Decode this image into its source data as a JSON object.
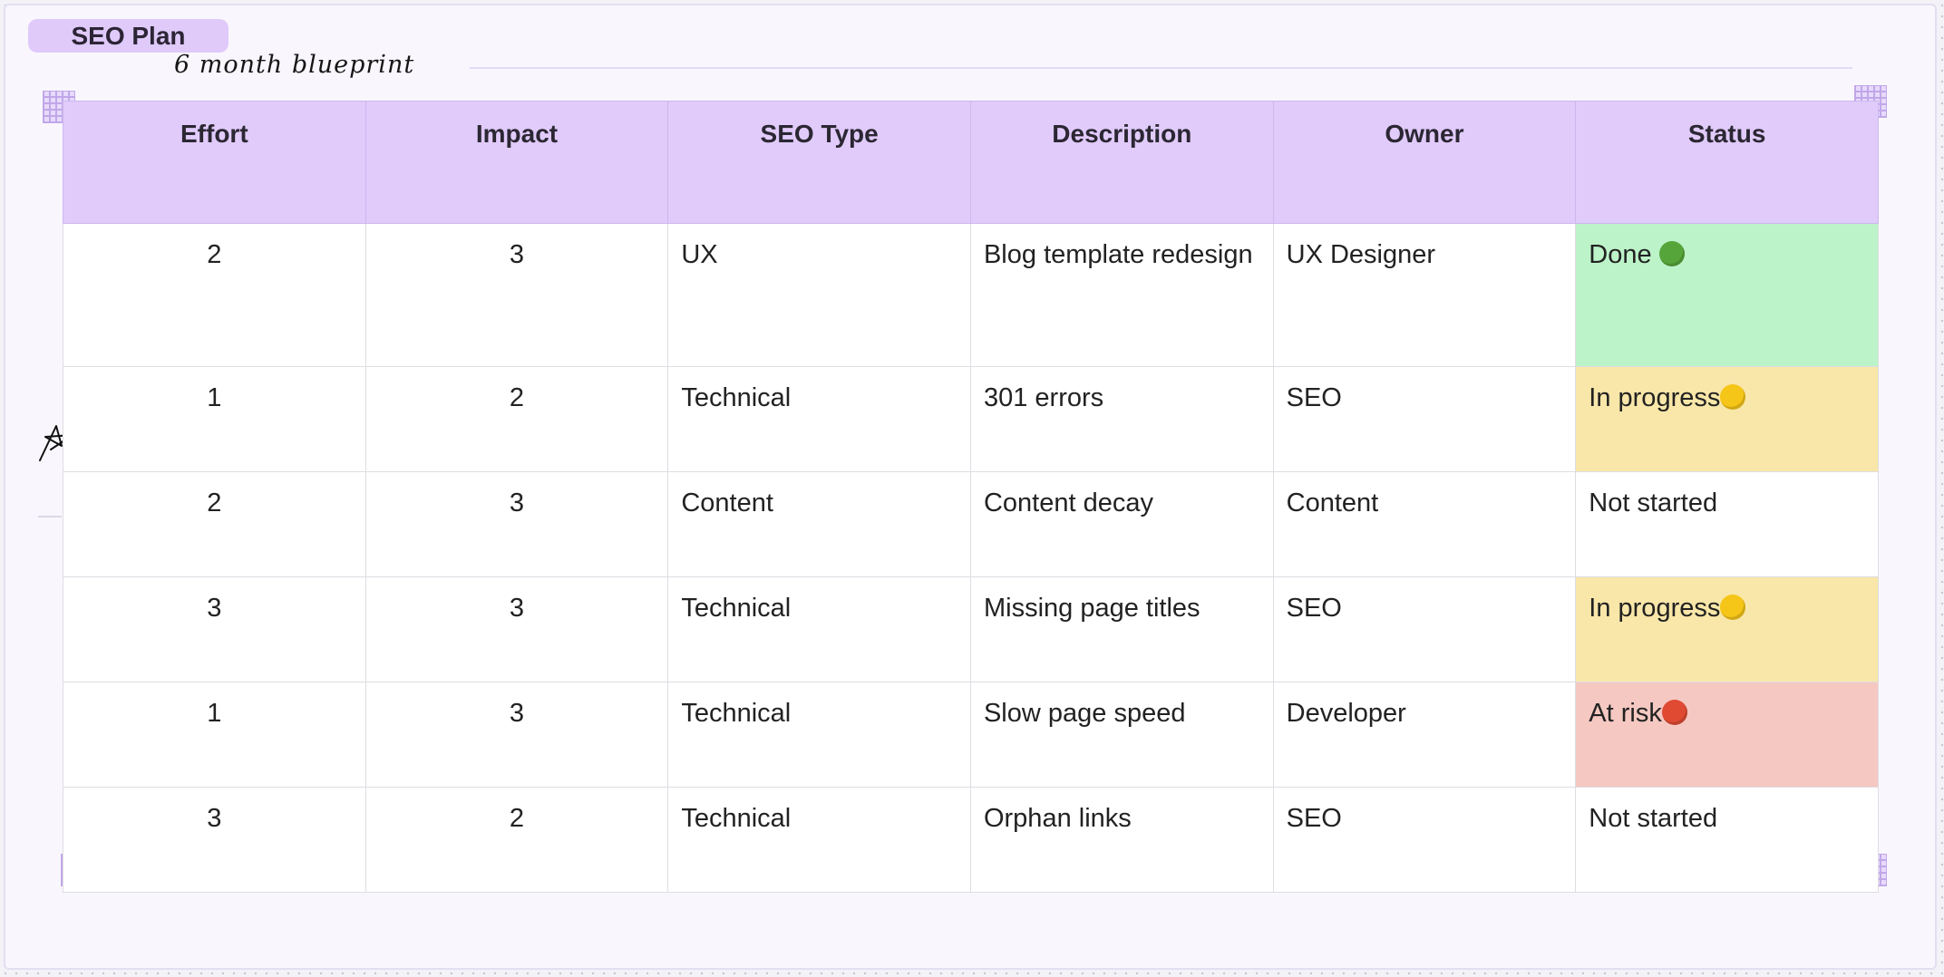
{
  "header": {
    "tag": "SEO Plan",
    "subtitle": "6 month blueprint"
  },
  "table": {
    "columns": [
      "Effort",
      "Impact",
      "SEO Type",
      "Description",
      "Owner",
      "Status"
    ],
    "rows": [
      {
        "effort": "2",
        "impact": "3",
        "type": "UX",
        "description": "Blog template redesign",
        "owner": "UX Designer",
        "status": "Done ",
        "status_key": "done"
      },
      {
        "effort": "1",
        "impact": "2",
        "type": "Technical",
        "description": "301 errors",
        "owner": "SEO",
        "status": "In progress",
        "status_key": "progress"
      },
      {
        "effort": "2",
        "impact": "3",
        "type": "Content",
        "description": "Content decay",
        "owner": "Content",
        "status": "Not started",
        "status_key": "none"
      },
      {
        "effort": "3",
        "impact": "3",
        "type": "Technical",
        "description": "Missing page titles",
        "owner": "SEO",
        "status": "In progress",
        "status_key": "progress"
      },
      {
        "effort": "1",
        "impact": "3",
        "type": "Technical",
        "description": "Slow page speed",
        "owner": "Developer",
        "status": "At risk",
        "status_key": "risk"
      },
      {
        "effort": "3",
        "impact": "2",
        "type": "Technical",
        "description": "Orphan links",
        "owner": "SEO",
        "status": "Not started",
        "status_key": "none"
      }
    ]
  },
  "colors": {
    "done": "#bdf3c9",
    "progress": "#f9e7a9",
    "risk": "#f5c8c2",
    "header": "#e1cbfb",
    "dot_green": "#56a53a",
    "dot_yellow": "#f5c518",
    "dot_red": "#e04a33"
  },
  "icons": {
    "cursor": "pen-star-cursor-icon",
    "dot_done": "green-circle-icon",
    "dot_progress": "yellow-circle-icon",
    "dot_risk": "red-circle-icon"
  }
}
